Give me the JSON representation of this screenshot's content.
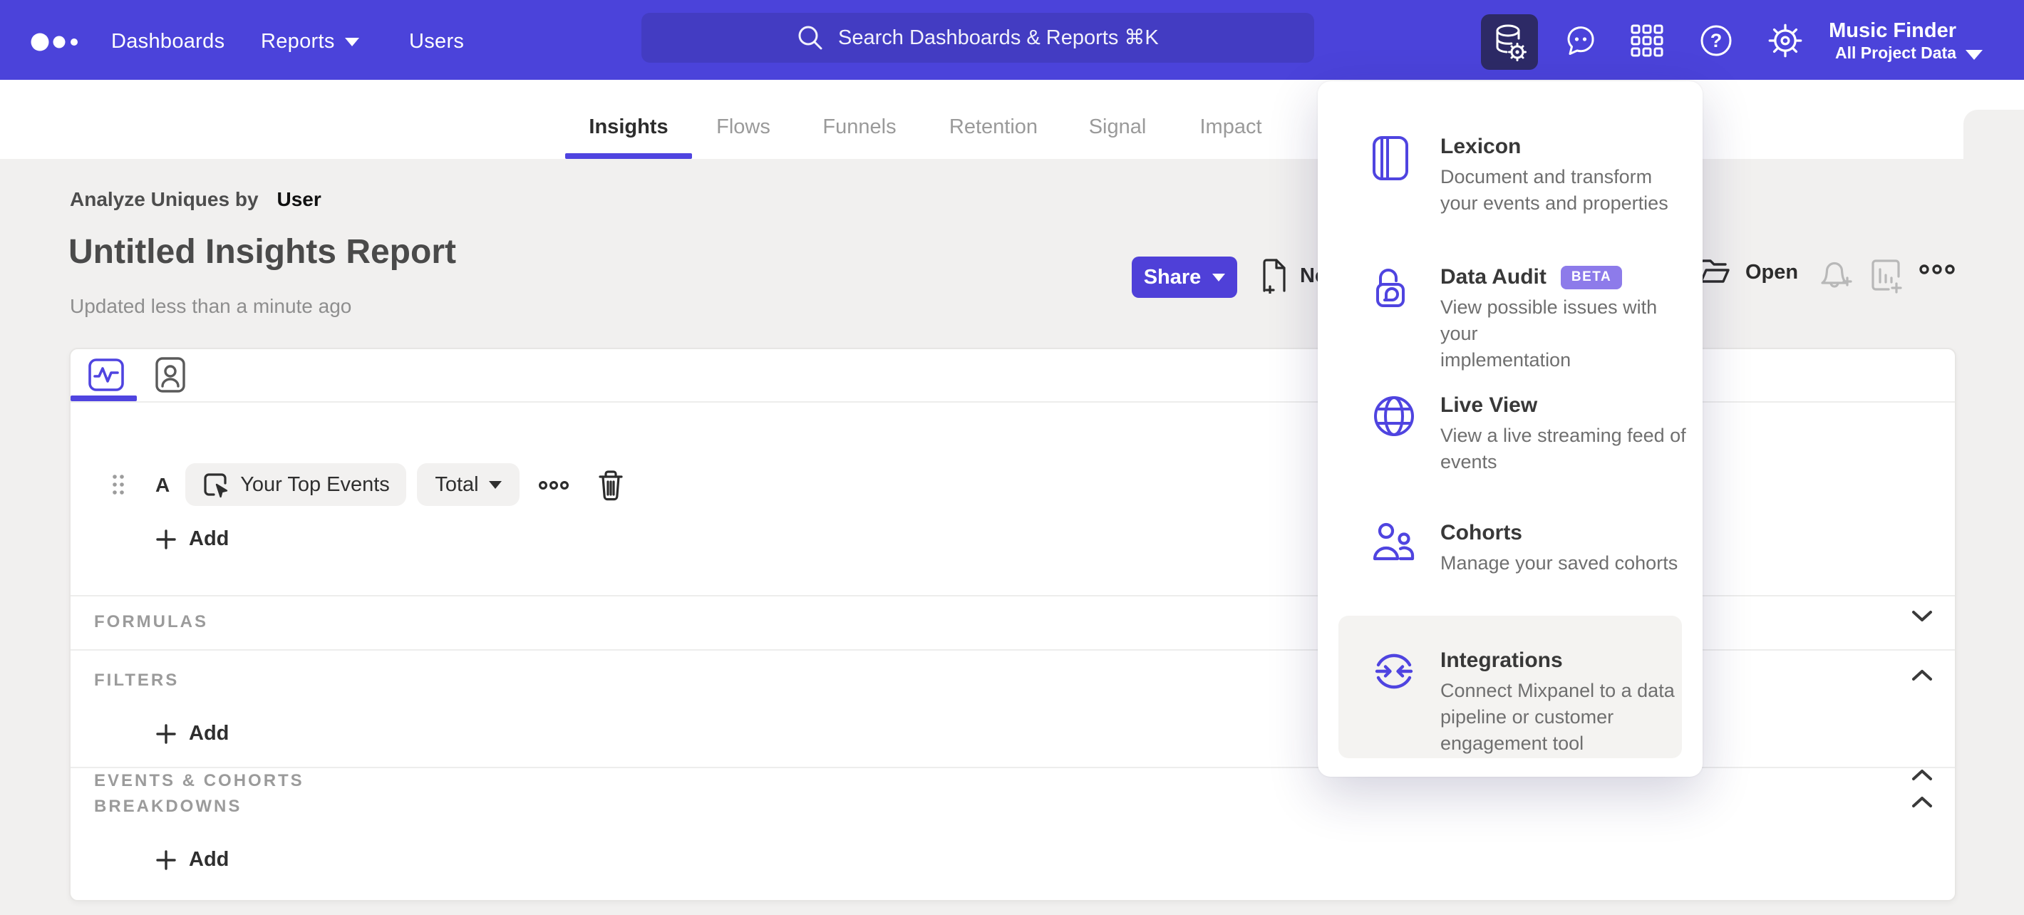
{
  "header": {
    "nav": [
      {
        "label": "Dashboards"
      },
      {
        "label": "Reports"
      },
      {
        "label": "Users"
      }
    ],
    "search_placeholder": "Search Dashboards & Reports ⌘K",
    "project_name": "Music Finder",
    "project_scope": "All Project Data"
  },
  "tabs": [
    {
      "label": "Insights"
    },
    {
      "label": "Flows"
    },
    {
      "label": "Funnels"
    },
    {
      "label": "Retention"
    },
    {
      "label": "Signal"
    },
    {
      "label": "Impact"
    }
  ],
  "report": {
    "analyze_prefix": "Analyze Uniques by",
    "analyze_entity": "User",
    "title": "Untitled Insights Report",
    "updated": "Updated less than a minute ago"
  },
  "actions": {
    "share_label": "Share",
    "new_label": "New",
    "open_label": "Open"
  },
  "builder": {
    "events_label": "EVENTS & COHORTS",
    "series_letter": "A",
    "event_button": "Your Top Events",
    "metric_button": "Total",
    "add_label": "Add",
    "formulas_label": "FORMULAS",
    "filters_label": "FILTERS",
    "breakdowns_label": "BREAKDOWNS"
  },
  "menu": {
    "items": [
      {
        "title": "Lexicon",
        "desc": "Document and transform\nyour events and properties"
      },
      {
        "title": "Data Audit",
        "badge": "BETA",
        "desc": "View possible issues with your\nimplementation"
      },
      {
        "title": "Live View",
        "desc": "View a live streaming feed of\nevents"
      },
      {
        "title": "Cohorts",
        "desc": "Manage your saved cohorts"
      },
      {
        "title": "Integrations",
        "desc": "Connect Mixpanel to a data\npipeline or customer\nengagement tool"
      }
    ]
  },
  "icons": {
    "logo": "mixpanel-three-dots",
    "search": "magnifier",
    "active_tile": "database-gear",
    "feedback": "chat-bubble",
    "apps": "grid-3x3",
    "help": "question-circle",
    "settings": "gear",
    "lexicon": "book",
    "data_audit": "padlock",
    "live_view": "globe",
    "cohorts": "people",
    "integrations": "sync-arrows"
  },
  "colors": {
    "brand": "#4b43da",
    "accent": "#4f44e0",
    "active_tile_bg": "#2d2a66",
    "beta_badge": "#8d7bea",
    "canvas": "#f1f0ef"
  }
}
